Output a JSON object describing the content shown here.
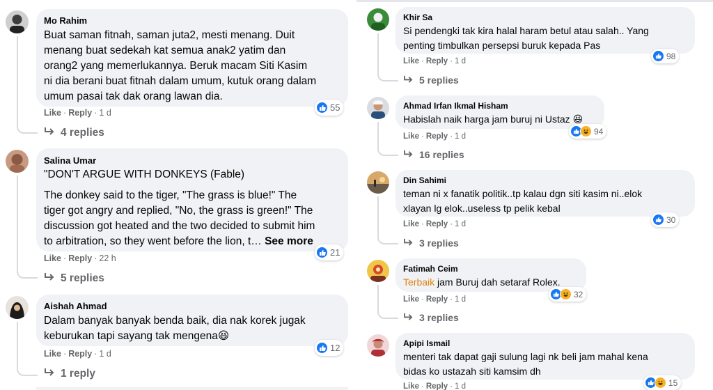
{
  "labels": {
    "like": "Like",
    "reply": "Reply",
    "see_more": "See more"
  },
  "colors": {
    "bubble": "#f0f2f5",
    "meta": "#65676b",
    "like_blue": "#1877f2",
    "haha_yellow": "#f7b125",
    "highlight": "#e0820e"
  },
  "left": [
    {
      "author": "Mo Rahim",
      "text": [
        "Buat saman fitnah, saman juta2, mesti menang. Duit",
        "menang buat sedekah kat semua anak2 yatim dan",
        "orang2 yang memerlukannya. Beruk macam Siti Kasim",
        "ni dia berani buat fitnah dalam umum, kutuk orang dalam",
        "umum pasai tak dak orang lawan dia."
      ],
      "time": "1 d",
      "reactions": [
        "like-icon"
      ],
      "reaction_count": "55",
      "replies": "4 replies"
    },
    {
      "author": "Salina Umar",
      "text": [
        "\"DON'T ARGUE WITH DONKEYS (Fable)",
        "",
        "The donkey said to the tiger, \"The grass is blue!\" The",
        "tiger got angry and replied, \"No, the grass is green!\" The",
        "discussion got heated and the two decided to submit him",
        "to arbitration, so they went before the lion, t… "
      ],
      "time": "22 h",
      "reactions": [
        "like-icon"
      ],
      "reaction_count": "21",
      "replies": "5 replies"
    },
    {
      "author": "Aishah Ahmad",
      "text": [
        "Dalam banyak banyak benda baik, dia nak korek jugak",
        "keburukan tapi sayang tak mengena😆"
      ],
      "time": "1 d",
      "reactions": [
        "like-icon"
      ],
      "reaction_count": "12",
      "replies": "1 reply"
    }
  ],
  "right": [
    {
      "author": "Khir Sa",
      "text": [
        "Si pendengki tak kira halal haram betul atau salah.. Yang",
        "penting timbulkan persepsi buruk kepada Pas"
      ],
      "time": "1 d",
      "reactions": [
        "like-icon"
      ],
      "reaction_count": "98",
      "replies": "5 replies"
    },
    {
      "author": "Ahmad Irfan Ikmal Hisham",
      "text": [
        "Habislah naik harga jam buruj ni Ustaz 😆"
      ],
      "time": "1 d",
      "reactions": [
        "like-icon",
        "haha-icon"
      ],
      "reaction_count": "94",
      "replies": "16 replies"
    },
    {
      "author": "Din Sahimi",
      "text": [
        "teman ni x fanatik politik..tp kalau dgn siti kasim ni..elok",
        "xlayan lg elok..useless tp pelik kebal"
      ],
      "time": "1 d",
      "reactions": [
        "like-icon"
      ],
      "reaction_count": "30",
      "replies": "3 replies"
    },
    {
      "author": "Fatimah Ceim",
      "highlight": "Terbaik",
      "text": [
        " jam Buruj dah setaraf Rolex."
      ],
      "time": "1 d",
      "reactions": [
        "like-icon",
        "haha-icon"
      ],
      "reaction_count": "32",
      "replies": "3 replies"
    },
    {
      "author": "Apipi Ismail",
      "text": [
        "menteri tak dapat gaji sulung lagi nk beli jam mahal kena",
        "bidas ko ustazah siti kamsim dh"
      ],
      "time": "1 d",
      "reactions": [
        "like-icon",
        "haha-icon"
      ],
      "reaction_count": "15"
    }
  ]
}
